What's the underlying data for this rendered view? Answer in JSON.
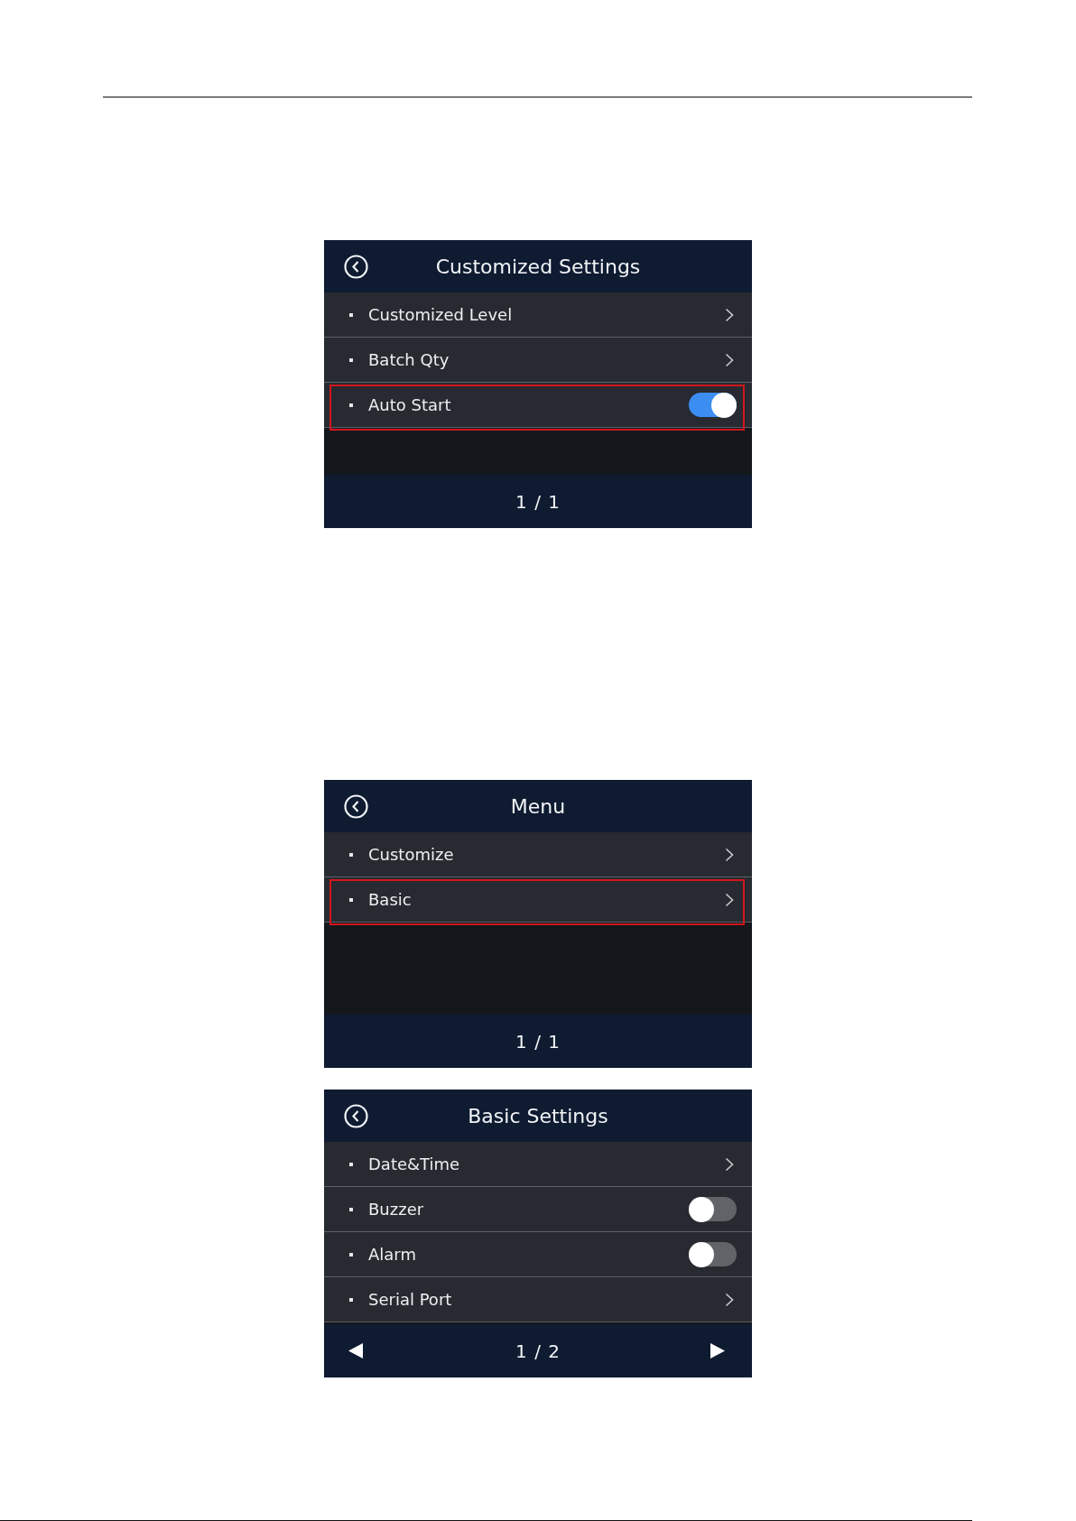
{
  "screens": [
    {
      "title": "Customized Settings",
      "items": [
        {
          "label": "Customized Level",
          "kind": "link",
          "highlighted": false
        },
        {
          "label": "Batch Qty",
          "kind": "link",
          "highlighted": false
        },
        {
          "label": "Auto Start",
          "kind": "toggle",
          "on": true,
          "highlighted": true
        }
      ],
      "footer": {
        "page": "1 / 1",
        "arrows": false
      }
    },
    {
      "title": "Menu",
      "items": [
        {
          "label": "Customize",
          "kind": "link",
          "highlighted": false
        },
        {
          "label": "Basic",
          "kind": "link",
          "highlighted": true
        }
      ],
      "footer": {
        "page": "1 / 1",
        "arrows": false
      }
    },
    {
      "title": "Basic Settings",
      "items": [
        {
          "label": "Date&Time",
          "kind": "link",
          "highlighted": false
        },
        {
          "label": "Buzzer",
          "kind": "toggle",
          "on": false,
          "highlighted": false
        },
        {
          "label": "Alarm",
          "kind": "toggle",
          "on": false,
          "highlighted": false
        },
        {
          "label": "Serial Port",
          "kind": "link",
          "highlighted": false
        }
      ],
      "footer": {
        "page": "1 / 2",
        "arrows": true
      }
    }
  ]
}
